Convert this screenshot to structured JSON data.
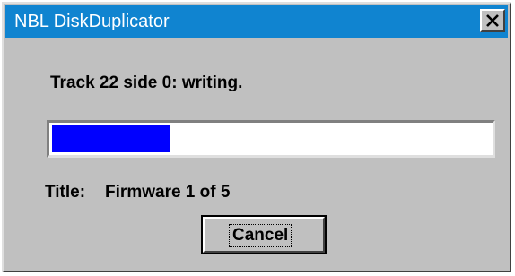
{
  "window": {
    "title": "NBL DiskDuplicator",
    "titlebar_color": "#1084d0"
  },
  "title_bar_buttons": {
    "close_icon": "close-icon"
  },
  "status": {
    "text": "Track 22 side 0: writing."
  },
  "progress": {
    "fraction": 0.27,
    "fill_color": "#0000ff"
  },
  "disk_title": {
    "label": "Title:",
    "value": "Firmware 1 of 5"
  },
  "buttons": {
    "cancel_label": "Cancel"
  }
}
